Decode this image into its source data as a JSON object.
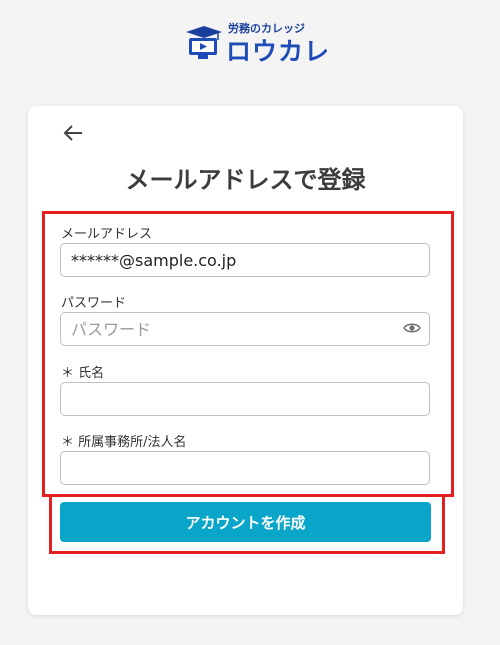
{
  "brand": {
    "tagline": "労務のカレッジ",
    "name": "ロウカレ",
    "primary_color": "#1d4bb8",
    "cap_color": "#1b3f9c"
  },
  "header": {
    "back_icon": "arrow-left-icon",
    "title": "メールアドレスで登録"
  },
  "form": {
    "email": {
      "label": "メールアドレス",
      "value": "******@sample.co.jp"
    },
    "password": {
      "label": "パスワード",
      "placeholder": "パスワード",
      "toggle_icon": "eye-icon"
    },
    "name": {
      "label": "＊ 氏名",
      "value": ""
    },
    "office": {
      "label": "＊ 所属事務所/法人名",
      "value": ""
    }
  },
  "submit": {
    "label": "アカウントを作成",
    "color": "#0aa6c9"
  },
  "highlight_color": "#e51f1f"
}
